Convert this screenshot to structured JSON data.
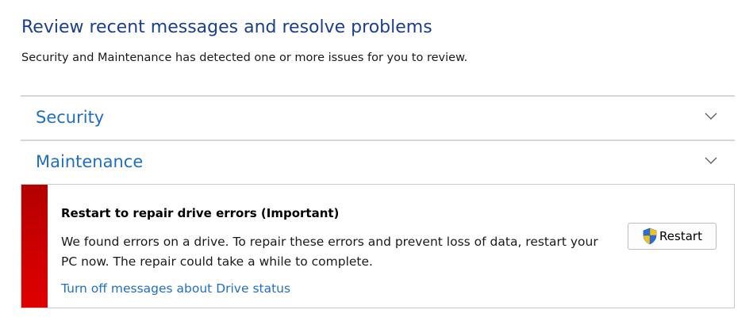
{
  "header": {
    "title": "Review recent messages and resolve problems",
    "subtitle": "Security and Maintenance has detected one or more issues for you to review."
  },
  "sections": [
    {
      "label": "Security",
      "icon": "chevron-down-icon"
    },
    {
      "label": "Maintenance",
      "icon": "chevron-down-icon"
    }
  ],
  "alert": {
    "title": "Restart to repair drive errors  (Important)",
    "message": "We found errors on a drive. To repair these errors and prevent loss of data, restart your PC now. The repair could take a while to complete.",
    "link_text": "Turn off messages about Drive status",
    "button_label": "Restart",
    "button_icon": "uac-shield-icon",
    "severity_color": "#cc0000"
  },
  "colors": {
    "title": "#1b3f8f",
    "link": "#1f6fc4",
    "divider": "#d6d6d6"
  }
}
